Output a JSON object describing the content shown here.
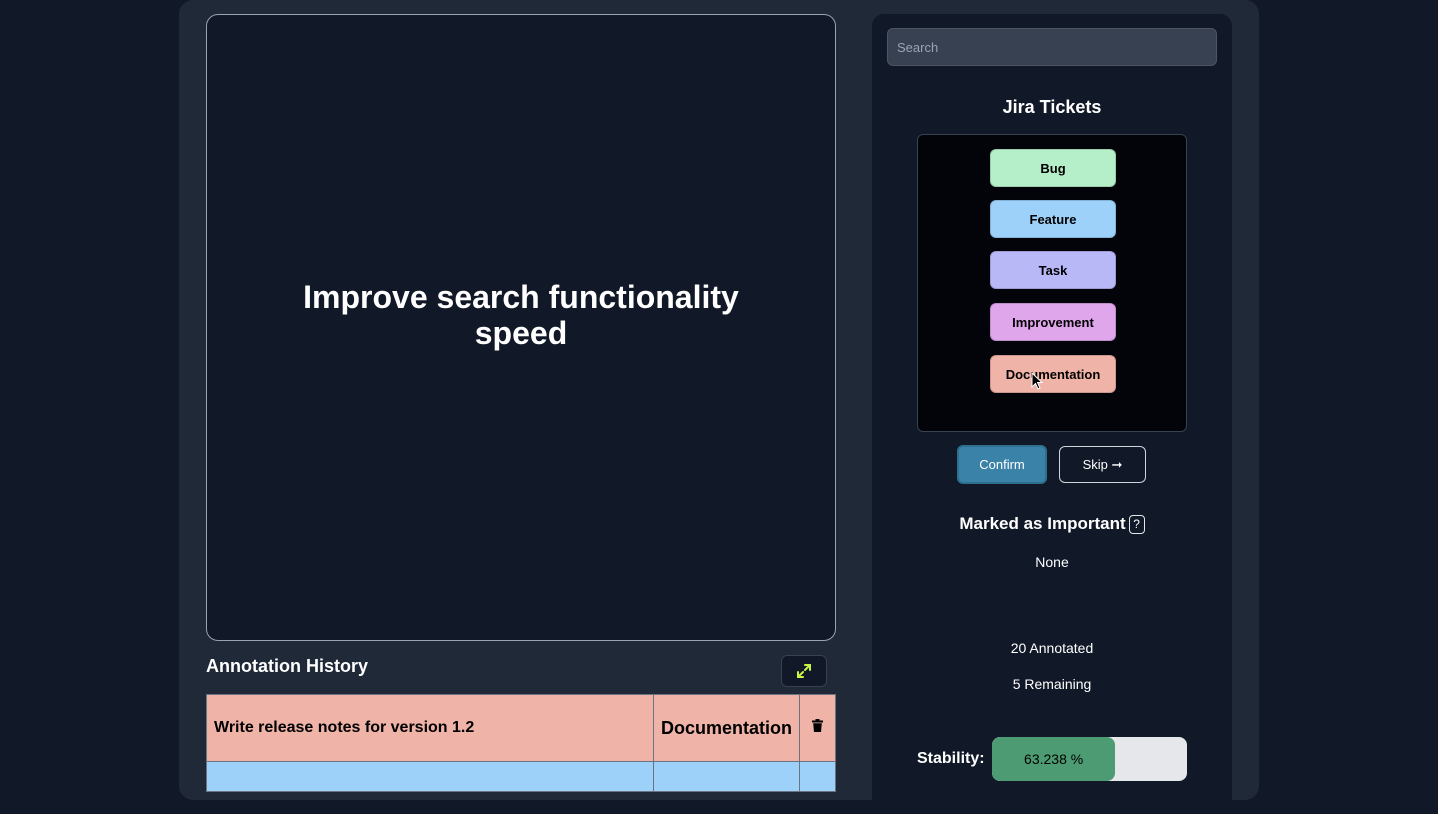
{
  "main": {
    "text": "Improve search functionality speed"
  },
  "history": {
    "title": "Annotation History",
    "rows": [
      {
        "text": "Write release notes for version 1.2",
        "category": "Documentation",
        "color": "#efb3a8"
      },
      {
        "text": "",
        "category": "",
        "color": "#9dd1fa"
      }
    ]
  },
  "sidebar": {
    "search_placeholder": "Search",
    "title": "Jira Tickets",
    "categories": [
      {
        "label": "Bug",
        "color": "#b5efc9"
      },
      {
        "label": "Feature",
        "color": "#9dd1fa"
      },
      {
        "label": "Task",
        "color": "#b9b8f7"
      },
      {
        "label": "Improvement",
        "color": "#e0a6ec"
      },
      {
        "label": "Documentation",
        "color": "#efb3a8"
      }
    ],
    "confirm_label": "Confirm",
    "skip_label": "Skip ➞",
    "important_title": "Marked as Important",
    "help_label": "?",
    "important_value": "None",
    "annotated": "20 Annotated",
    "remaining": "5 Remaining",
    "stability_label": "Stability:",
    "stability_value": "63.238 %",
    "stability_fraction": 0.632
  },
  "icons": {
    "expand": "expand-arrows-icon",
    "delete": "trash-icon"
  },
  "colors": {
    "confirm": "#3b82a8",
    "expand_icon": "#c7f542",
    "stability_fill": "#4d9b72"
  }
}
